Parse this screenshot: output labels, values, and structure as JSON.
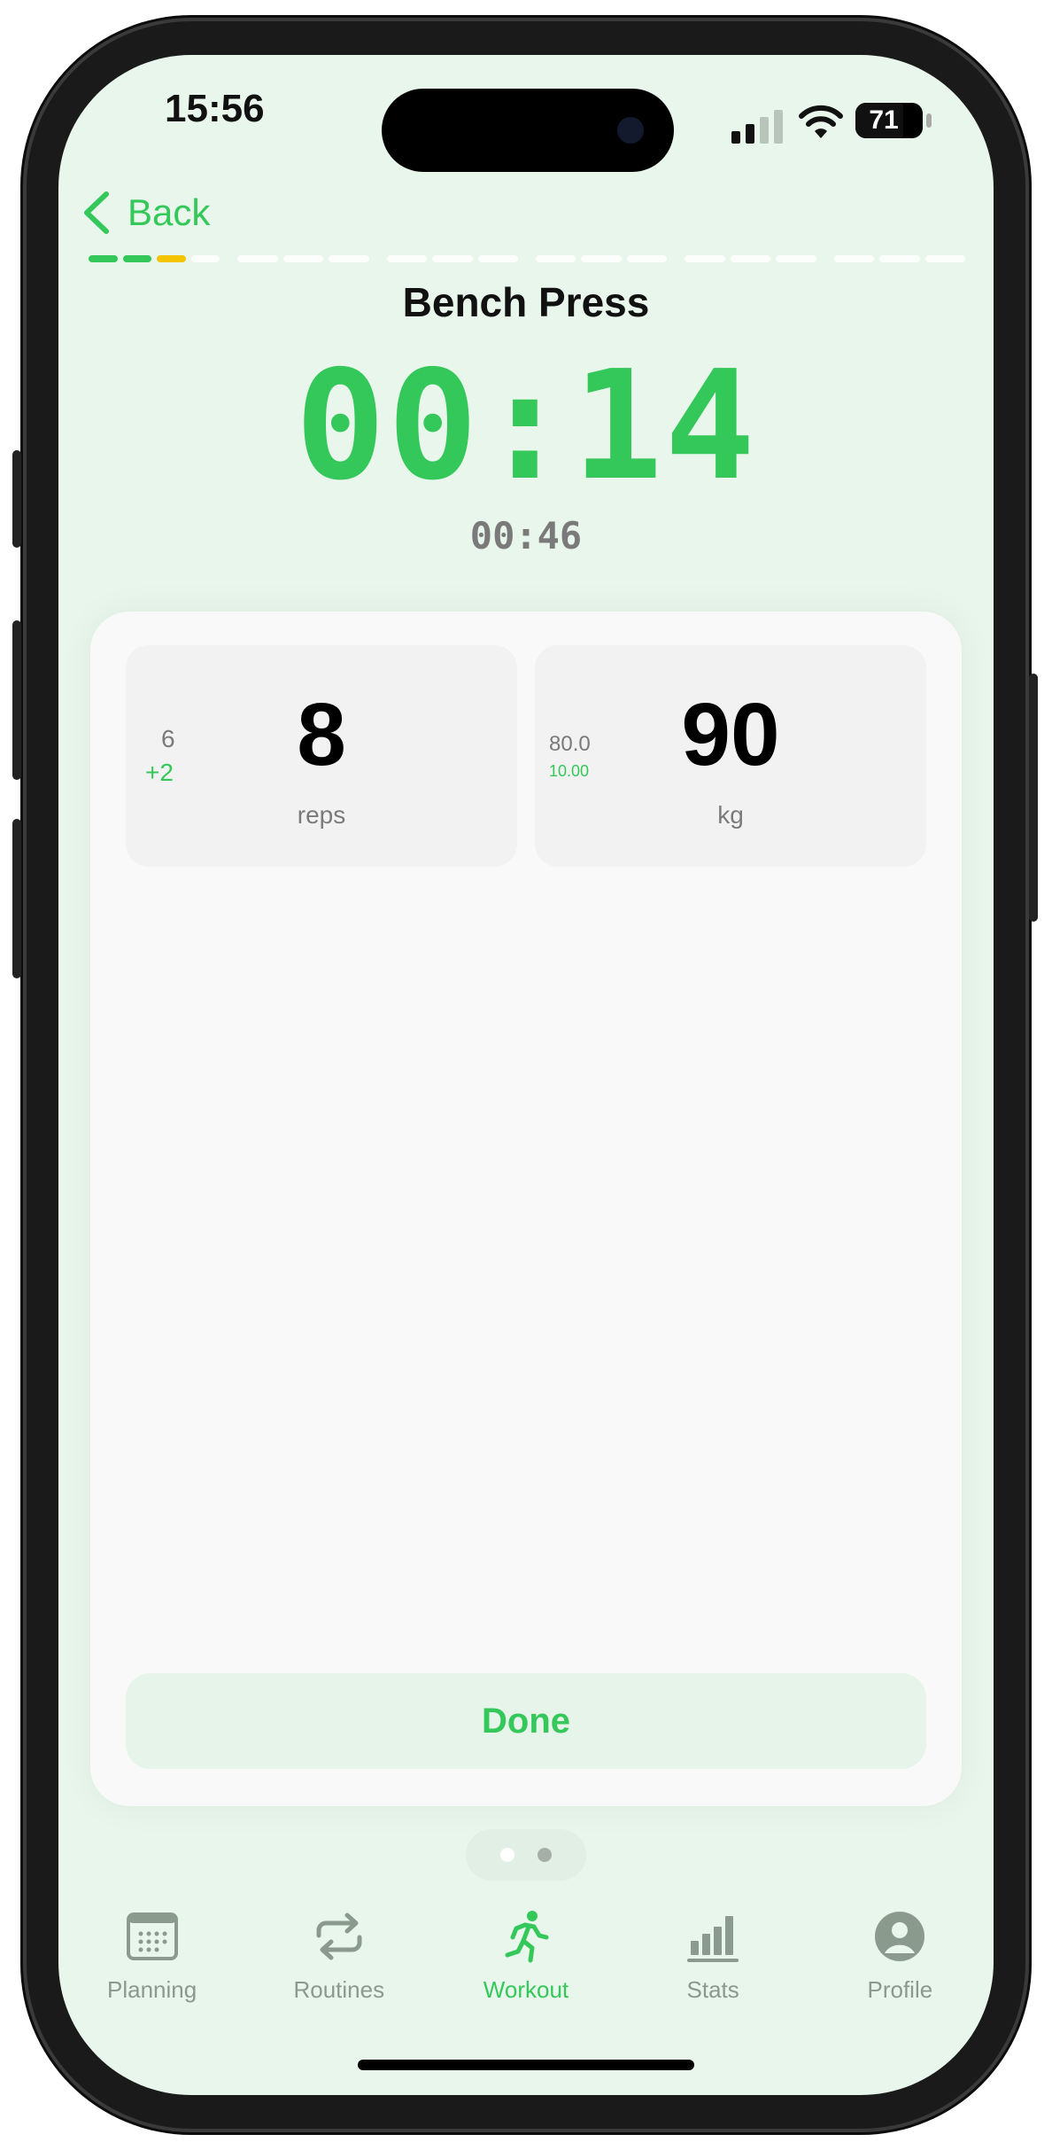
{
  "status_bar": {
    "time": "15:56",
    "battery": "71"
  },
  "nav": {
    "back_label": "Back"
  },
  "progress": {
    "groups": [
      [
        "done",
        "done",
        "current",
        "pending"
      ],
      [
        "pending",
        "pending",
        "pending"
      ],
      [
        "pending",
        "pending",
        "pending"
      ],
      [
        "pending",
        "pending",
        "pending"
      ],
      [
        "pending",
        "pending",
        "pending"
      ],
      [
        "pending",
        "pending",
        "pending"
      ]
    ]
  },
  "exercise": {
    "name": "Bench Press",
    "rest_timer": "00:14",
    "remaining": "00:46"
  },
  "reps": {
    "value": "8",
    "unit": "reps",
    "previous": "6",
    "delta": "+2"
  },
  "weight": {
    "value": "90",
    "unit": "kg",
    "previous": "80.0",
    "delta": "10.00"
  },
  "done_label": "Done",
  "tabs": [
    {
      "label": "Planning",
      "icon": "calendar-icon",
      "active": false
    },
    {
      "label": "Routines",
      "icon": "repeat-icon",
      "active": false
    },
    {
      "label": "Workout",
      "icon": "running-icon",
      "active": true
    },
    {
      "label": "Stats",
      "icon": "bar-chart-icon",
      "active": false
    },
    {
      "label": "Profile",
      "icon": "person-icon",
      "active": false
    }
  ],
  "colors": {
    "accent": "#34c759",
    "warning": "#f5c400",
    "background": "#e8f6eb"
  }
}
